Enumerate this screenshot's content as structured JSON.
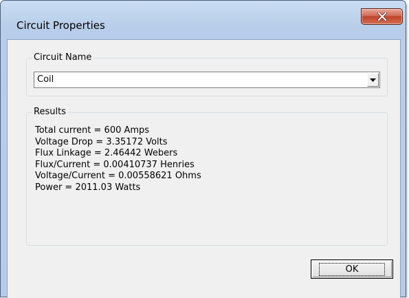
{
  "window": {
    "title": "Circuit Properties"
  },
  "circuit_name_group": {
    "label": "Circuit Name",
    "selected_value": "Coil"
  },
  "results_group": {
    "label": "Results",
    "lines": [
      "Total current = 600 Amps",
      "Voltage Drop = 3.35172 Volts",
      "Flux Linkage = 2.46442 Webers",
      "Flux/Current = 0.00410737 Henries",
      "Voltage/Current = 0.00558621 Ohms",
      "Power = 2011.03 Watts"
    ]
  },
  "buttons": {
    "ok_label": "OK"
  },
  "icons": {
    "close": "close-icon",
    "dropdown": "chevron-down-icon"
  },
  "colors": {
    "close_button": "#c74a33",
    "titlebar": "#b9cfe9",
    "dialog_background": "#f0f0f0"
  }
}
